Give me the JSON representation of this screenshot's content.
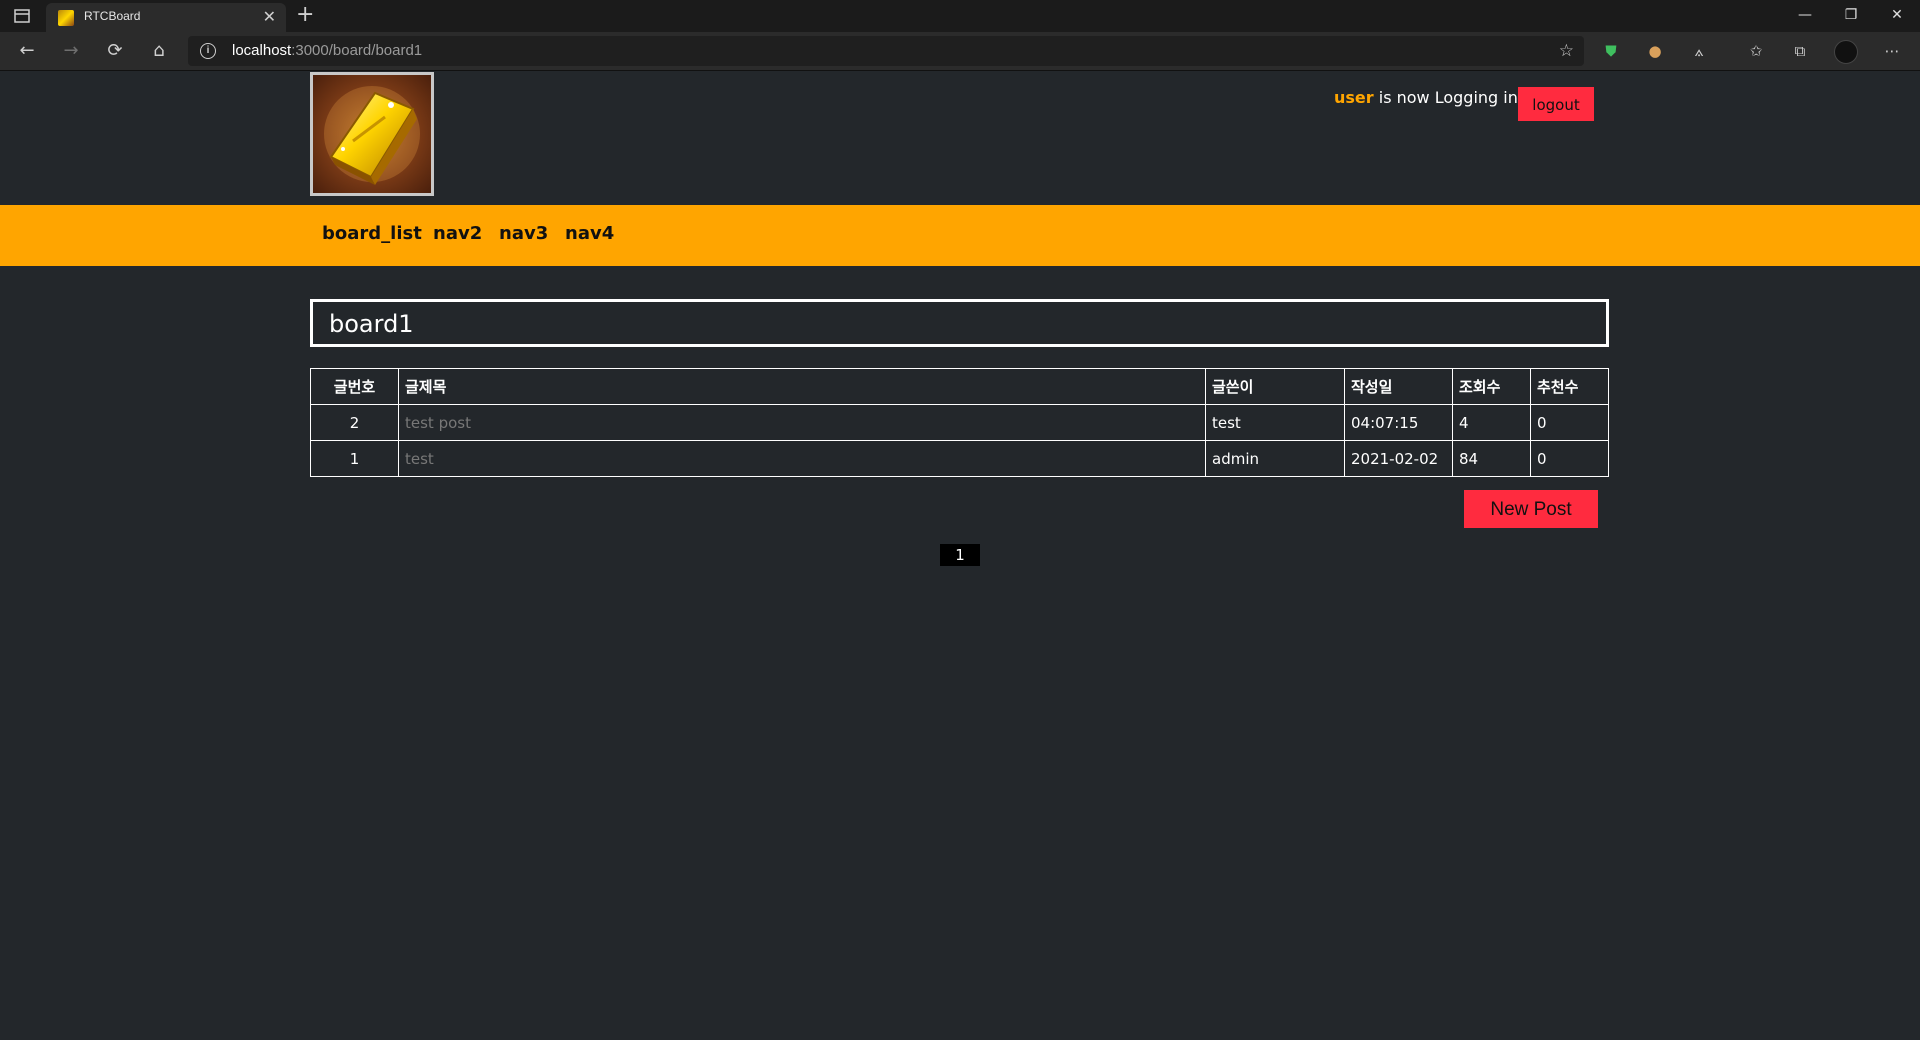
{
  "browser": {
    "tab_title": "RTCBoard",
    "tab_close": "✕",
    "new_tab": "+",
    "window_minimize": "—",
    "window_restore": "❐",
    "window_close": "✕",
    "url_host": "localhost",
    "url_path": ":3000/board/board1",
    "nav_back": "←",
    "nav_forward": "→",
    "nav_refresh": "⟳",
    "nav_home": "⌂",
    "fav_add": "☆",
    "ext_shield": "⛊",
    "ext_cookie": "●",
    "ext_other": "⟑",
    "favorites": "✩",
    "collections": "⧉",
    "more": "⋯"
  },
  "header": {
    "username": "user",
    "login_text": " is now Logging in",
    "logout_label": "logout"
  },
  "nav": {
    "items": [
      "board_list",
      "nav2",
      "nav3",
      "nav4"
    ]
  },
  "board": {
    "title": "board1",
    "columns": [
      "글번호",
      "글제목",
      "글쓴이",
      "작성일",
      "조회수",
      "추천수"
    ],
    "rows": [
      {
        "no": "2",
        "title": "test post",
        "author": "test",
        "date": "04:07:15",
        "views": "4",
        "likes": "0"
      },
      {
        "no": "1",
        "title": "test",
        "author": "admin",
        "date": "2021-02-02",
        "views": "84",
        "likes": "0"
      }
    ],
    "new_post_label": "New Post",
    "pages": [
      "1"
    ]
  },
  "colors": {
    "accent_orange": "#ffa500",
    "button_red": "#ff2b3f",
    "page_bg": "#23272b"
  }
}
